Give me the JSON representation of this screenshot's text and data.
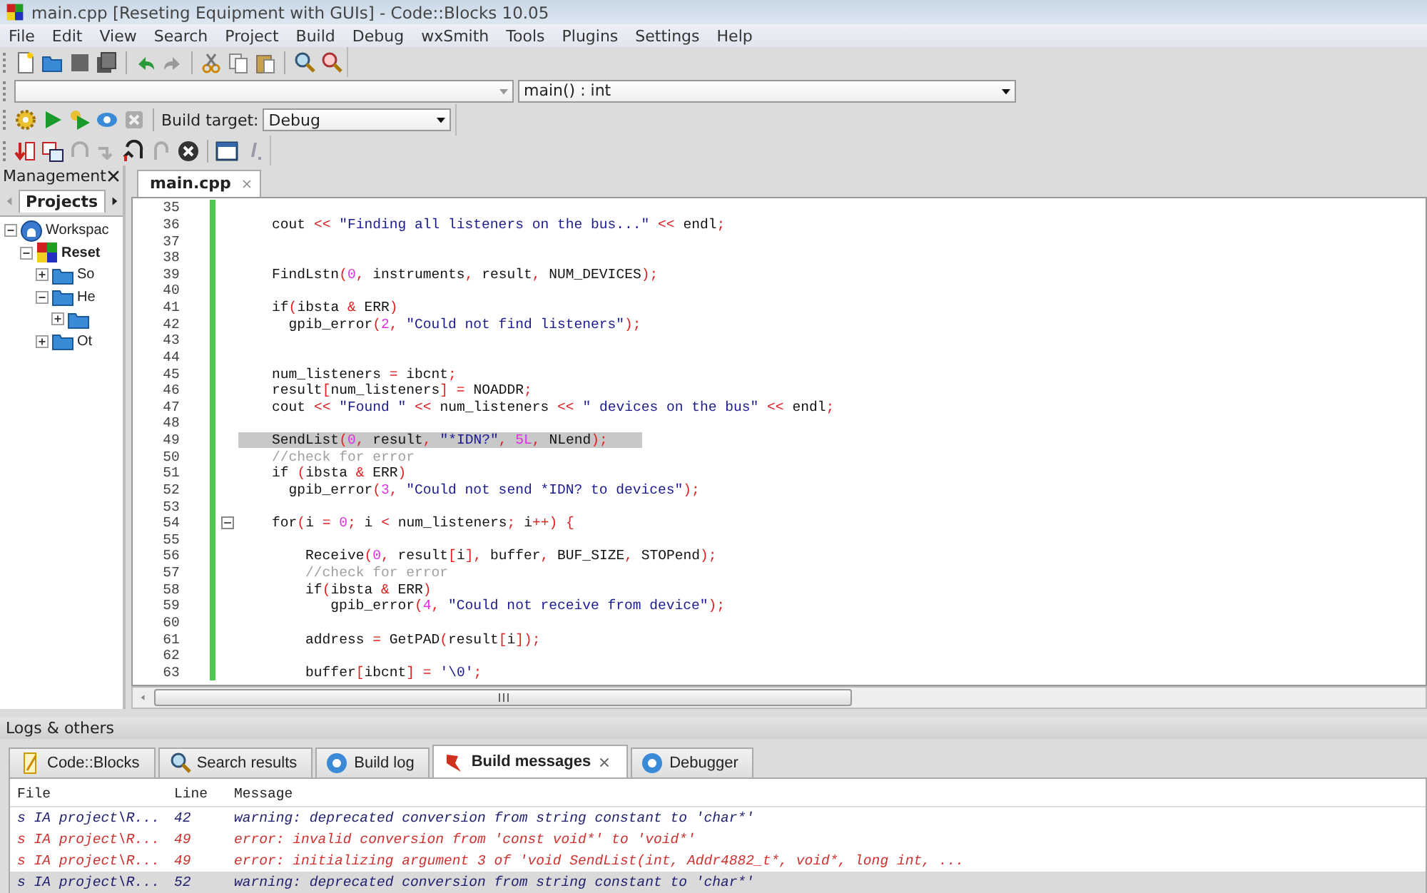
{
  "window": {
    "title": "main.cpp [Reseting Equipment with GUIs] - Code::Blocks 10.05"
  },
  "menu": [
    "File",
    "Edit",
    "View",
    "Search",
    "Project",
    "Build",
    "Debug",
    "wxSmith",
    "Tools",
    "Plugins",
    "Settings",
    "Help"
  ],
  "code_toolbar": {
    "function_value": "main() : int"
  },
  "build_toolbar": {
    "target_label": "Build target:",
    "target_value": "Debug"
  },
  "management": {
    "title": "Management",
    "tab": "Projects",
    "tree": [
      {
        "label": "Workspac",
        "expanded": true,
        "children": [
          {
            "label": "Reset",
            "expanded": true,
            "children": [
              {
                "label": "So",
                "expanded": false
              },
              {
                "label": "He",
                "expanded": true,
                "children": [
                  {
                    "expanded": false
                  }
                ]
              },
              {
                "label": "Ot",
                "expanded": false
              }
            ]
          }
        ]
      }
    ]
  },
  "editor": {
    "tab": "main.cpp",
    "lines": [
      {
        "number": "35"
      },
      {
        "number": "36",
        "text": "    cout << \"Finding all listeners on the bus...\" << endl;"
      },
      {
        "number": "37"
      },
      {
        "number": "38"
      },
      {
        "number": "39",
        "text": "    FindLstn(0, instruments, result, NUM_DEVICES);"
      },
      {
        "number": "40"
      },
      {
        "number": "41",
        "text": "    if(ibsta & ERR)"
      },
      {
        "number": "42",
        "text": "      gpib_error(2, \"Could not find listeners\");"
      },
      {
        "number": "43"
      },
      {
        "number": "44"
      },
      {
        "number": "45",
        "text": "    num_listeners = ibcnt;"
      },
      {
        "number": "46",
        "text": "    result[num_listeners] = NOADDR;"
      },
      {
        "number": "47",
        "text": "    cout << \"Found \" << num_listeners << \" devices on the bus\" << endl;"
      },
      {
        "number": "48"
      },
      {
        "number": "49",
        "text": "    SendList(0, result, \"*IDN?\", 5L, NLend);",
        "highlighted": true
      },
      {
        "number": "50",
        "text": "    //check for error"
      },
      {
        "number": "51",
        "text": "    if (ibsta & ERR)"
      },
      {
        "number": "52",
        "text": "      gpib_error(3, \"Could not send *IDN? to devices\");"
      },
      {
        "number": "53"
      },
      {
        "number": "54",
        "text": "    for(i = 0; i < num_listeners; i++) {",
        "fold": true
      },
      {
        "number": "55"
      },
      {
        "number": "56",
        "text": "        Receive(0, result[i], buffer, BUF_SIZE, STOPend);"
      },
      {
        "number": "57",
        "text": "        //check for error"
      },
      {
        "number": "58",
        "text": "        if(ibsta & ERR)"
      },
      {
        "number": "59",
        "text": "           gpib_error(4, \"Could not receive from device\");"
      },
      {
        "number": "60"
      },
      {
        "number": "61",
        "text": "        address = GetPAD(result[i]);"
      },
      {
        "number": "62"
      },
      {
        "number": "63",
        "text": "        buffer[ibcnt] = '\\0';"
      }
    ]
  },
  "logs": {
    "title": "Logs & others",
    "tabs": [
      {
        "label": "Code::Blocks",
        "selected": false
      },
      {
        "label": "Search results",
        "selected": false
      },
      {
        "label": "Build log",
        "selected": false
      },
      {
        "label": "Build messages",
        "selected": true
      },
      {
        "label": "Debugger",
        "selected": false
      }
    ],
    "columns": [
      "File",
      "Line",
      "Message"
    ],
    "rows": [
      {
        "file": "s IA project\\R...",
        "line": "42",
        "message": "warning: deprecated conversion from string constant to 'char*'",
        "kind": "warning",
        "selected": false
      },
      {
        "file": "s IA project\\R...",
        "line": "49",
        "message": "error: invalid conversion from 'const void*' to 'void*'",
        "kind": "error",
        "selected": false
      },
      {
        "file": "s IA project\\R...",
        "line": "49",
        "message": "error:   initializing argument 3 of 'void SendList(int, Addr4882_t*, void*, long int, ...",
        "kind": "error",
        "selected": false
      },
      {
        "file": "s IA project\\R...",
        "line": "52",
        "message": "warning: deprecated conversion from string constant to 'char*'",
        "kind": "warning",
        "selected": true
      }
    ]
  }
}
